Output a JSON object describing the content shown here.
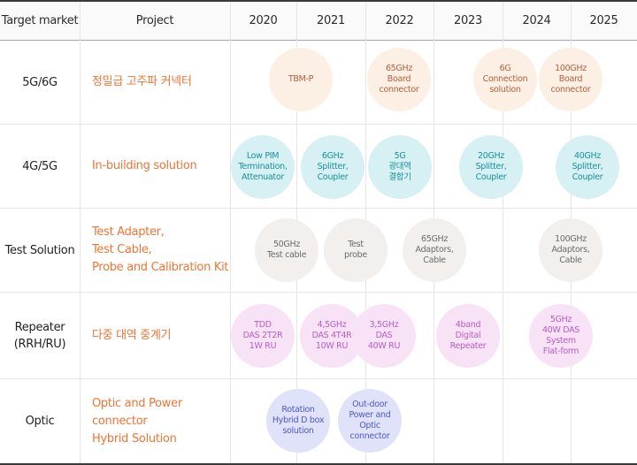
{
  "header": {
    "target_market": "Target market",
    "project": "Project",
    "years": [
      "2020",
      "2021",
      "2022",
      "2023",
      "2024",
      "2025"
    ]
  },
  "rows": [
    {
      "market": "5G/6G",
      "project": "정밀급 고주파 커넥터",
      "color": "orange",
      "items": [
        {
          "label": "TBM-P"
        },
        {
          "label": "65GHz\nBoard\nconnector"
        },
        {
          "label": "6G\nConnection\nsolution"
        },
        {
          "label": "100GHz\nBoard\nconnector"
        }
      ]
    },
    {
      "market": "4G/5G",
      "project": "In-building solution",
      "color": "teal",
      "items": [
        {
          "label": "Low PIM\nTermination,\nAttenuator"
        },
        {
          "label": "6GHz\nSplitter,\nCoupler"
        },
        {
          "label": "5G\n광대역\n결합기"
        },
        {
          "label": "20GHz\nSplitter,\nCoupler"
        },
        {
          "label": "40GHz\nSplitter,\nCoupler"
        }
      ]
    },
    {
      "market": "Test Solution",
      "project": "Test Adapter,\nTest Cable,\nProbe and Calibration Kit",
      "color": "gray",
      "items": [
        {
          "label": "50GHz\nTest cable"
        },
        {
          "label": "Test\nprobe"
        },
        {
          "label": "65GHz\nAdaptors,\nCable"
        },
        {
          "label": "100GHz\nAdaptors,\nCable"
        }
      ]
    },
    {
      "market": "Repeater\n(RRH/RU)",
      "project": "다중 대역 중계기",
      "color": "pink",
      "items": [
        {
          "label": "TDD\nDAS 2T2R\n1W RU"
        },
        {
          "label": "4,5GHz\nDAS 4T4R\n10W RU"
        },
        {
          "label": "3,5GHz\nDAS\n40W RU"
        },
        {
          "label": "4band\nDigital\nRepeater"
        },
        {
          "label": "5GHz\n40W DAS\nSystem\nFlat-form"
        }
      ]
    },
    {
      "market": "Optic",
      "project": "Optic and Power\nconnector\nHybrid Solution",
      "color": "blue",
      "items": [
        {
          "label": "Rotation\nHybrid D box\nsolution"
        },
        {
          "label": "Out-door\nPower and\nOptic\nconnector"
        }
      ]
    }
  ]
}
